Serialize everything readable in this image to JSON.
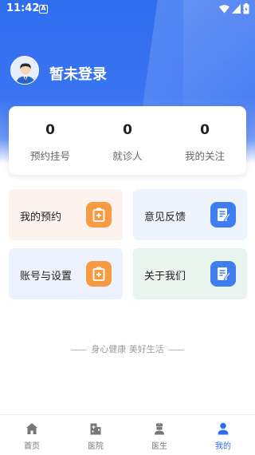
{
  "status_bar": {
    "time": "11:42",
    "notification": "A"
  },
  "user": {
    "name": "暂未登录"
  },
  "stats": [
    {
      "count": "0",
      "label": "预约挂号"
    },
    {
      "count": "0",
      "label": "就诊人"
    },
    {
      "count": "0",
      "label": "我的关注"
    }
  ],
  "menu": [
    {
      "label": "我的预约",
      "icon": "medical-kit-icon"
    },
    {
      "label": "意见反馈",
      "icon": "edit-note-icon"
    },
    {
      "label": "账号与设置",
      "icon": "medical-kit-icon"
    },
    {
      "label": "关于我们",
      "icon": "edit-note-icon"
    }
  ],
  "slogan": "身心健康 美好生活",
  "tabs": [
    {
      "label": "首页",
      "icon": "home-icon"
    },
    {
      "label": "医院",
      "icon": "hospital-icon"
    },
    {
      "label": "医生",
      "icon": "doctor-icon"
    },
    {
      "label": "我的",
      "icon": "user-icon",
      "active": true
    }
  ],
  "colors": {
    "primary": "#2f6df0",
    "orange": "#f79b43",
    "blue": "#3f7ef0"
  }
}
